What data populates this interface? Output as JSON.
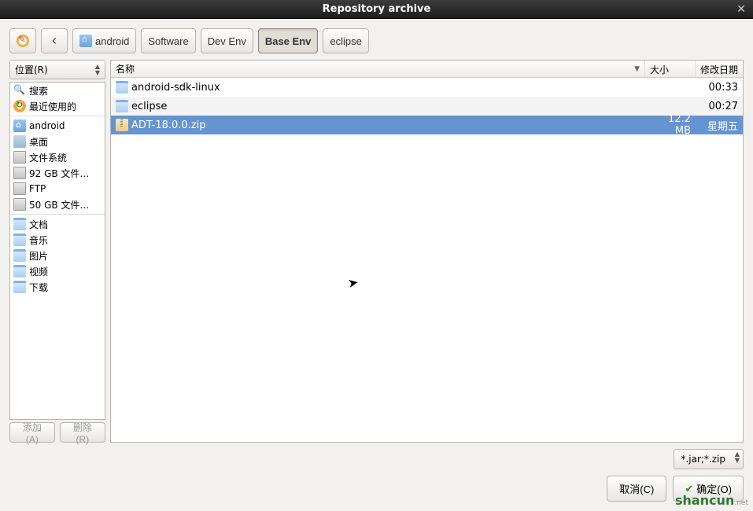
{
  "window": {
    "title": "Repository archive"
  },
  "toolbar": {
    "path_segments": [
      "android",
      "Software",
      "Dev Env",
      "Base Env",
      "eclipse"
    ],
    "active_index": 3
  },
  "places_panel": {
    "header": "位置(R)",
    "groups": [
      [
        {
          "icon": "search",
          "label": "搜索"
        },
        {
          "icon": "recent",
          "label": "最近使用的"
        }
      ],
      [
        {
          "icon": "home",
          "label": "android"
        },
        {
          "icon": "desktop",
          "label": "桌面"
        },
        {
          "icon": "disk",
          "label": "文件系统"
        },
        {
          "icon": "disk",
          "label": "92 GB 文件…"
        },
        {
          "icon": "disk",
          "label": "FTP"
        },
        {
          "icon": "disk",
          "label": "50 GB 文件…"
        }
      ],
      [
        {
          "icon": "folder",
          "label": "文档"
        },
        {
          "icon": "folder",
          "label": "音乐"
        },
        {
          "icon": "folder",
          "label": "图片"
        },
        {
          "icon": "folder",
          "label": "视频"
        },
        {
          "icon": "folder",
          "label": "下载"
        }
      ]
    ],
    "add_label": "添加(A)",
    "remove_label": "删除(R)"
  },
  "file_panel": {
    "columns": {
      "name": "名称",
      "size": "大小",
      "date": "修改日期"
    },
    "rows": [
      {
        "icon": "folder",
        "name": "android-sdk-linux",
        "size": "",
        "date": "00:33",
        "alt": false,
        "selected": false
      },
      {
        "icon": "folder",
        "name": "eclipse",
        "size": "",
        "date": "00:27",
        "alt": true,
        "selected": false
      },
      {
        "icon": "zip",
        "name": "ADT-18.0.0.zip",
        "size": "12.2 MB",
        "date": "星期五",
        "alt": false,
        "selected": true
      }
    ]
  },
  "filter": {
    "value": "*.jar;*.zip"
  },
  "actions": {
    "cancel": "取消(C)",
    "ok": "确定(O)"
  },
  "watermark": {
    "main": "shancun",
    "suffix": ".net"
  }
}
